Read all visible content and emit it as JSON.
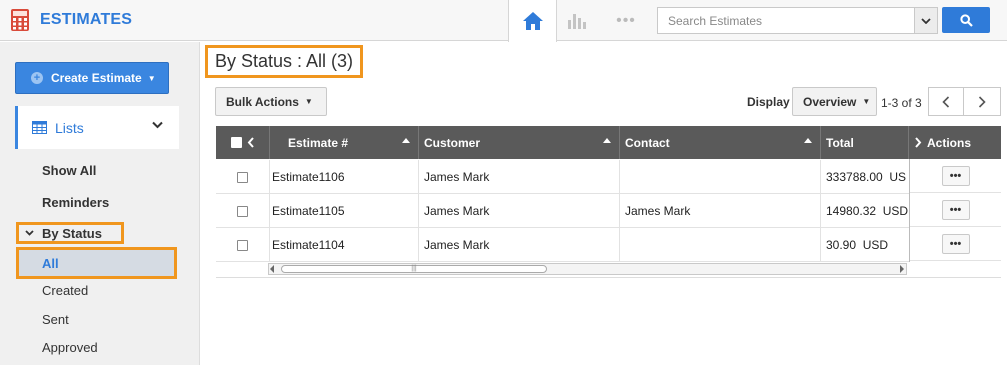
{
  "app": {
    "title": "ESTIMATES",
    "brand_color": "#2f7bd9",
    "highlight_color": "#f0961e"
  },
  "topnav": {
    "home_icon": "home-icon",
    "chart_icon": "bar-chart-icon",
    "more_icon": "more-dots-icon",
    "more_glyph": "•••",
    "search_placeholder": "Search Estimates"
  },
  "sidebar": {
    "create_button": "Create Estimate",
    "lists_label": "Lists",
    "items": [
      {
        "label": "Show All"
      },
      {
        "label": "Reminders"
      }
    ],
    "by_status": {
      "label": "By Status",
      "children": [
        {
          "label": "All",
          "selected": true
        },
        {
          "label": "Created"
        },
        {
          "label": "Sent"
        },
        {
          "label": "Approved"
        }
      ]
    }
  },
  "main": {
    "heading": "By Status : All (3)",
    "bulk_actions": "Bulk Actions",
    "display_label": "Display",
    "display_value": "Overview",
    "pager_text": "1-3 of 3",
    "columns": {
      "estimate": "Estimate #",
      "customer": "Customer",
      "contact": "Contact",
      "total": "Total",
      "actions": "Actions"
    },
    "rows": [
      {
        "estimate": "Estimate1106",
        "customer": "James Mark",
        "contact": "",
        "total": "333788.00  US",
        "action": "•••"
      },
      {
        "estimate": "Estimate1105",
        "customer": "James Mark",
        "contact": "James Mark",
        "total": "14980.32  USD",
        "action": "•••"
      },
      {
        "estimate": "Estimate1104",
        "customer": "James Mark",
        "contact": "",
        "total": "30.90  USD",
        "action": "•••"
      }
    ],
    "scroll_thumb_grip": "|||"
  }
}
